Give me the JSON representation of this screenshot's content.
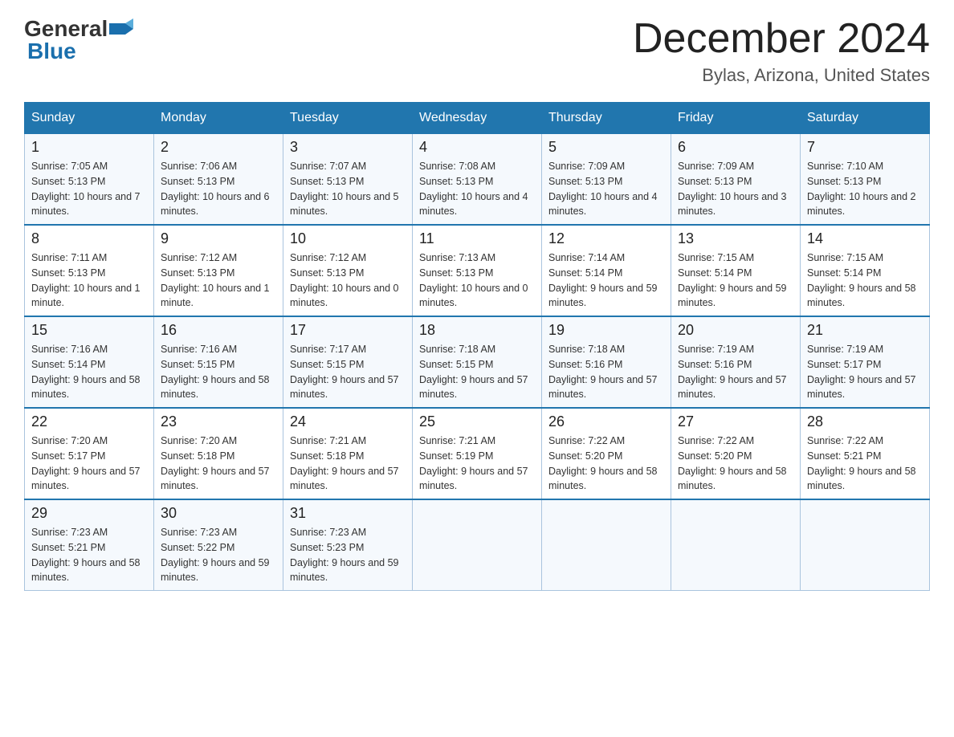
{
  "header": {
    "logo_text_general": "General",
    "logo_text_blue": "Blue",
    "title": "December 2024",
    "subtitle": "Bylas, Arizona, United States"
  },
  "days_header": [
    "Sunday",
    "Monday",
    "Tuesday",
    "Wednesday",
    "Thursday",
    "Friday",
    "Saturday"
  ],
  "weeks": [
    [
      {
        "day": "1",
        "sunrise": "7:05 AM",
        "sunset": "5:13 PM",
        "daylight": "10 hours and 7 minutes."
      },
      {
        "day": "2",
        "sunrise": "7:06 AM",
        "sunset": "5:13 PM",
        "daylight": "10 hours and 6 minutes."
      },
      {
        "day": "3",
        "sunrise": "7:07 AM",
        "sunset": "5:13 PM",
        "daylight": "10 hours and 5 minutes."
      },
      {
        "day": "4",
        "sunrise": "7:08 AM",
        "sunset": "5:13 PM",
        "daylight": "10 hours and 4 minutes."
      },
      {
        "day": "5",
        "sunrise": "7:09 AM",
        "sunset": "5:13 PM",
        "daylight": "10 hours and 4 minutes."
      },
      {
        "day": "6",
        "sunrise": "7:09 AM",
        "sunset": "5:13 PM",
        "daylight": "10 hours and 3 minutes."
      },
      {
        "day": "7",
        "sunrise": "7:10 AM",
        "sunset": "5:13 PM",
        "daylight": "10 hours and 2 minutes."
      }
    ],
    [
      {
        "day": "8",
        "sunrise": "7:11 AM",
        "sunset": "5:13 PM",
        "daylight": "10 hours and 1 minute."
      },
      {
        "day": "9",
        "sunrise": "7:12 AM",
        "sunset": "5:13 PM",
        "daylight": "10 hours and 1 minute."
      },
      {
        "day": "10",
        "sunrise": "7:12 AM",
        "sunset": "5:13 PM",
        "daylight": "10 hours and 0 minutes."
      },
      {
        "day": "11",
        "sunrise": "7:13 AM",
        "sunset": "5:13 PM",
        "daylight": "10 hours and 0 minutes."
      },
      {
        "day": "12",
        "sunrise": "7:14 AM",
        "sunset": "5:14 PM",
        "daylight": "9 hours and 59 minutes."
      },
      {
        "day": "13",
        "sunrise": "7:15 AM",
        "sunset": "5:14 PM",
        "daylight": "9 hours and 59 minutes."
      },
      {
        "day": "14",
        "sunrise": "7:15 AM",
        "sunset": "5:14 PM",
        "daylight": "9 hours and 58 minutes."
      }
    ],
    [
      {
        "day": "15",
        "sunrise": "7:16 AM",
        "sunset": "5:14 PM",
        "daylight": "9 hours and 58 minutes."
      },
      {
        "day": "16",
        "sunrise": "7:16 AM",
        "sunset": "5:15 PM",
        "daylight": "9 hours and 58 minutes."
      },
      {
        "day": "17",
        "sunrise": "7:17 AM",
        "sunset": "5:15 PM",
        "daylight": "9 hours and 57 minutes."
      },
      {
        "day": "18",
        "sunrise": "7:18 AM",
        "sunset": "5:15 PM",
        "daylight": "9 hours and 57 minutes."
      },
      {
        "day": "19",
        "sunrise": "7:18 AM",
        "sunset": "5:16 PM",
        "daylight": "9 hours and 57 minutes."
      },
      {
        "day": "20",
        "sunrise": "7:19 AM",
        "sunset": "5:16 PM",
        "daylight": "9 hours and 57 minutes."
      },
      {
        "day": "21",
        "sunrise": "7:19 AM",
        "sunset": "5:17 PM",
        "daylight": "9 hours and 57 minutes."
      }
    ],
    [
      {
        "day": "22",
        "sunrise": "7:20 AM",
        "sunset": "5:17 PM",
        "daylight": "9 hours and 57 minutes."
      },
      {
        "day": "23",
        "sunrise": "7:20 AM",
        "sunset": "5:18 PM",
        "daylight": "9 hours and 57 minutes."
      },
      {
        "day": "24",
        "sunrise": "7:21 AM",
        "sunset": "5:18 PM",
        "daylight": "9 hours and 57 minutes."
      },
      {
        "day": "25",
        "sunrise": "7:21 AM",
        "sunset": "5:19 PM",
        "daylight": "9 hours and 57 minutes."
      },
      {
        "day": "26",
        "sunrise": "7:22 AM",
        "sunset": "5:20 PM",
        "daylight": "9 hours and 58 minutes."
      },
      {
        "day": "27",
        "sunrise": "7:22 AM",
        "sunset": "5:20 PM",
        "daylight": "9 hours and 58 minutes."
      },
      {
        "day": "28",
        "sunrise": "7:22 AM",
        "sunset": "5:21 PM",
        "daylight": "9 hours and 58 minutes."
      }
    ],
    [
      {
        "day": "29",
        "sunrise": "7:23 AM",
        "sunset": "5:21 PM",
        "daylight": "9 hours and 58 minutes."
      },
      {
        "day": "30",
        "sunrise": "7:23 AM",
        "sunset": "5:22 PM",
        "daylight": "9 hours and 59 minutes."
      },
      {
        "day": "31",
        "sunrise": "7:23 AM",
        "sunset": "5:23 PM",
        "daylight": "9 hours and 59 minutes."
      },
      null,
      null,
      null,
      null
    ]
  ],
  "labels": {
    "sunrise": "Sunrise:",
    "sunset": "Sunset:",
    "daylight": "Daylight:"
  },
  "colors": {
    "header_bg": "#2176ae",
    "border": "#aac4de",
    "row_even": "#f5f9fd",
    "row_odd": "#ffffff"
  }
}
